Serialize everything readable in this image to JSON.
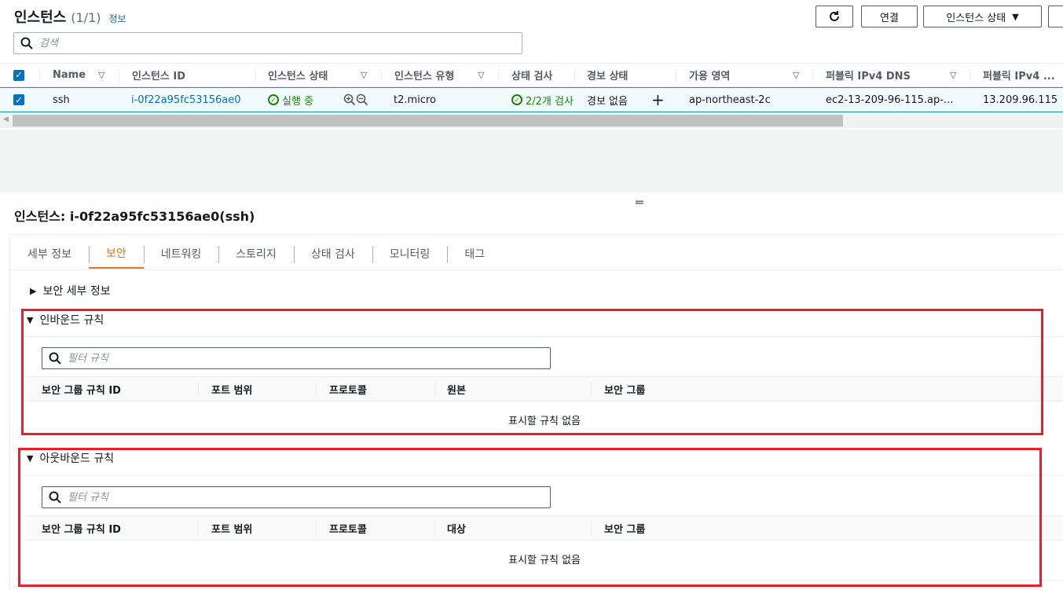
{
  "header": {
    "title": "인스턴스",
    "count": "(1/1)",
    "info_link": "정보",
    "connect_label": "연결",
    "instance_state_label": "인스턴스 상태",
    "search_placeholder": "검색"
  },
  "table": {
    "columns": [
      "Name",
      "인스턴스 ID",
      "인스턴스 상태",
      "인스턴스 유형",
      "상태 검사",
      "경보 상태",
      "가용 영역",
      "퍼블릭 IPv4 DNS",
      "퍼블릭 IPv4 ..."
    ],
    "row": {
      "name": "ssh",
      "instance_id": "i-0f22a95fc53156ae0",
      "state": "실행 중",
      "type": "t2.micro",
      "status_check": "2/2개 검사",
      "alarm": "경보 없음",
      "az": "ap-northeast-2c",
      "dns": "ec2-13-209-96-115.ap-...",
      "ip": "13.209.96.115"
    }
  },
  "detail": {
    "title": "인스턴스: i-0f22a95fc53156ae0(ssh)",
    "tabs": [
      "세부 정보",
      "보안",
      "네트워킹",
      "스토리지",
      "상태 검사",
      "모니터링",
      "태그"
    ],
    "security_details": "보안 세부 정보",
    "inbound": {
      "title": "인바운드 규칙",
      "filter_placeholder": "필터 규칙",
      "columns": [
        "보안 그룹 규칙 ID",
        "포트 범위",
        "프로토콜",
        "원본",
        "보안 그룹"
      ],
      "empty": "표시할 규칙 없음"
    },
    "outbound": {
      "title": "아웃바운드 규칙",
      "filter_placeholder": "필터 규칙",
      "columns": [
        "보안 그룹 규칙 ID",
        "포트 범위",
        "프로토콜",
        "대상",
        "보안 그룹"
      ],
      "empty": "표시할 규칙 없음"
    }
  },
  "colors": {
    "accent": "#0073bb",
    "active_tab": "#ec7211",
    "success": "#1d8102",
    "highlight_box": "#e8202a"
  }
}
